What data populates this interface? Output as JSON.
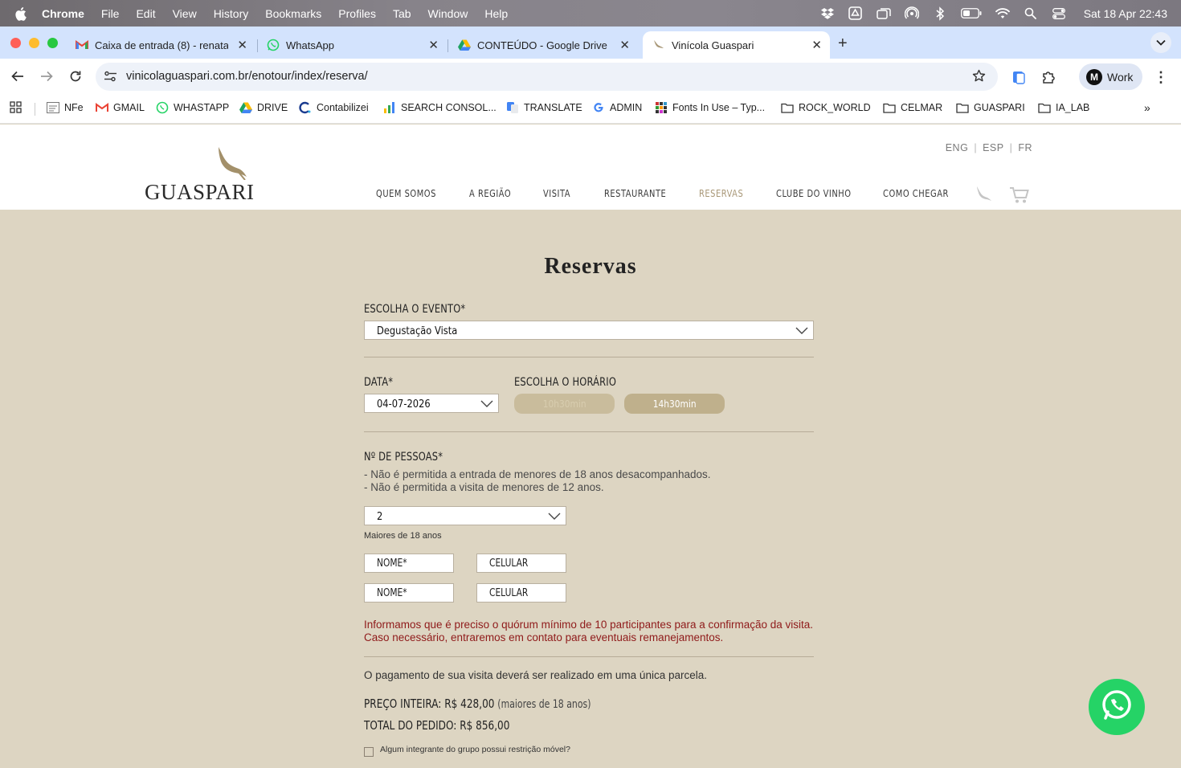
{
  "menubar": {
    "app": "Chrome",
    "items": [
      "File",
      "Edit",
      "View",
      "History",
      "Bookmarks",
      "Profiles",
      "Tab",
      "Window",
      "Help"
    ],
    "clock": "Sat 18 Apr  22:43"
  },
  "tabs": [
    {
      "label": "Caixa de entrada (8) - renata",
      "icon": "gmail-icon"
    },
    {
      "label": "WhatsApp",
      "icon": "whatsapp-icon"
    },
    {
      "label": "CONTEÚDO - Google Drive",
      "icon": "drive-icon"
    },
    {
      "label": "Vinícola Guaspari",
      "icon": "guaspari-icon",
      "active": true
    }
  ],
  "toolbar": {
    "url": "vinicolaguaspari.com.br/enotour/index/reserva/",
    "profile_initial": "M",
    "profile_label": "Work"
  },
  "bookmarks": [
    {
      "label": "NFe",
      "icon": "nfe-icon"
    },
    {
      "label": "GMAIL",
      "icon": "gmail-icon"
    },
    {
      "label": "WHASTAPP",
      "icon": "whatsapp-icon"
    },
    {
      "label": "DRIVE",
      "icon": "drive-icon"
    },
    {
      "label": "Contabilizei",
      "icon": "contabilizei-icon"
    },
    {
      "label": "SEARCH CONSOL...",
      "icon": "search-console-icon"
    },
    {
      "label": "TRANSLATE",
      "icon": "translate-icon"
    },
    {
      "label": "ADMIN",
      "icon": "google-icon"
    },
    {
      "label": "Fonts In Use – Typ...",
      "icon": "fontsinuse-icon"
    },
    {
      "label": "ROCK_WORLD",
      "icon": "folder-icon"
    },
    {
      "label": "CELMAR",
      "icon": "folder-icon"
    },
    {
      "label": "GUASPARI",
      "icon": "folder-icon"
    },
    {
      "label": "IA_LAB",
      "icon": "folder-icon"
    }
  ],
  "site": {
    "logo_text": "GUASPARI",
    "languages": [
      "ENG",
      "ESP",
      "FR"
    ],
    "nav": [
      {
        "label": "QUEM SOMOS"
      },
      {
        "label": "A REGIÃO"
      },
      {
        "label": "VISITA"
      },
      {
        "label": "RESTAURANTE"
      },
      {
        "label": "RESERVAS",
        "active": true
      },
      {
        "label": "CLUBE DO VINHO"
      },
      {
        "label": "COMO CHEGAR"
      }
    ],
    "nav_active_color": "#a99878"
  },
  "form": {
    "title": "Reservas",
    "event_label": "ESCOLHA O EVENTO*",
    "event_value": "Degustação Vista",
    "date_label": "DATA*",
    "date_value": "04-07-2026",
    "time_label": "ESCOLHA O HORÁRIO",
    "time_options": [
      {
        "label": "10h30min",
        "disabled": true
      },
      {
        "label": "14h30min",
        "disabled": false
      }
    ],
    "people_label": "Nº DE PESSOAS*",
    "people_note_1": "- Não é permitida a entrada de menores de 18 anos desacompanhados.",
    "people_note_2": "- Não é permitida a visita de menores de 12 anos.",
    "people_value": "2",
    "adults_note": "Maiores de 18 anos",
    "guests": [
      {
        "name_placeholder": "NOME*",
        "phone_placeholder": "CELULAR"
      },
      {
        "name_placeholder": "NOME*",
        "phone_placeholder": "CELULAR"
      }
    ],
    "warning": "Informamos que é preciso o quórum mínimo de 10 participantes para a confirmação da visita. Caso necessário, entraremos em contato para eventuais remanejamentos.",
    "payment_note": "O pagamento de sua visita deverá ser realizado em uma única parcela.",
    "price_label": "PREÇO INTEIRA: R$ 428,00",
    "price_sub": "(maiores de 18 anos)",
    "total_label": "TOTAL DO PEDIDO: R$ 856,00",
    "mobility_question": "Algum integrante do grupo possui restrição móvel?",
    "accent_color": "#bfb08c",
    "warning_color": "#8f1a1a"
  }
}
